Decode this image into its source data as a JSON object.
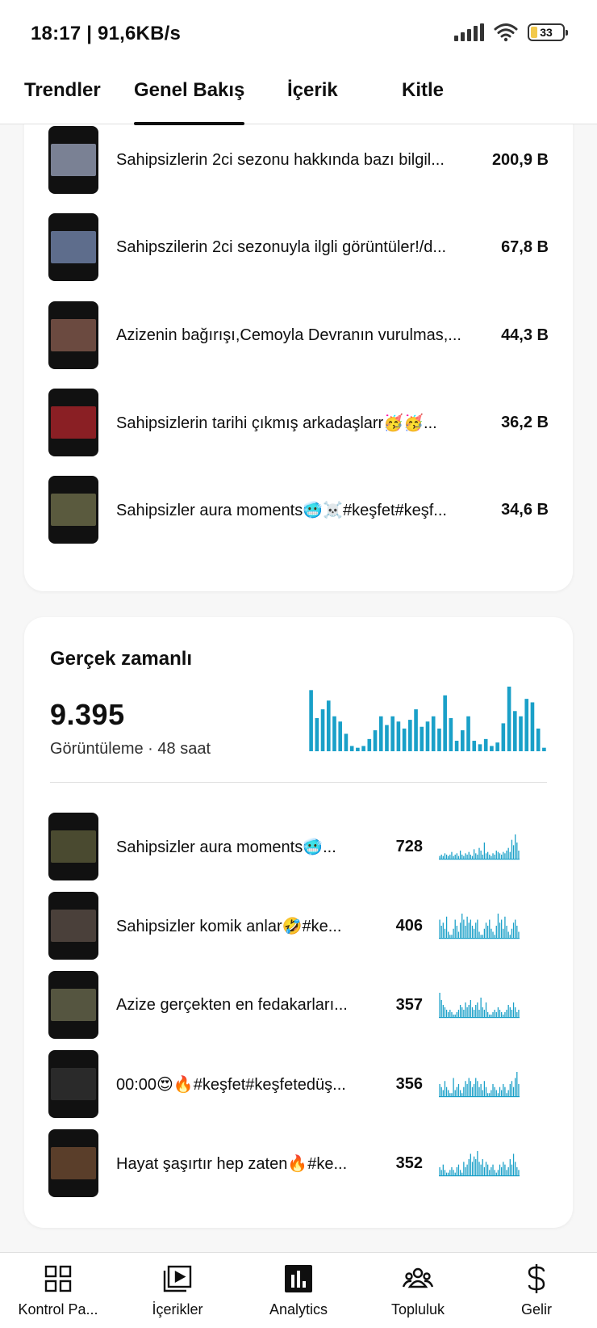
{
  "status_bar": {
    "time": "18:17 | 91,6KB/s",
    "battery": "33"
  },
  "tabs": [
    {
      "label": "Trendler"
    },
    {
      "label": "Genel Bakış",
      "active": true
    },
    {
      "label": "İçerik"
    },
    {
      "label": "Kitle"
    }
  ],
  "top_content": [
    {
      "title": "Sahipsizlerin 2ci sezonu hakkında bazı bilgil...",
      "value": "200,9 B",
      "thumb_color": "#7a8194"
    },
    {
      "title": "Sahipszilerin 2ci sezonuyla ilgli görüntüler!/d...",
      "value": "67,8 B",
      "thumb_color": "#5e6d8c"
    },
    {
      "title": "Azizenin bağırışı,Cemoyla Devranın vurulmas,...",
      "value": "44,3 B",
      "thumb_color": "#6b4a40"
    },
    {
      "title": "Sahipsizlerin tarihi çıkmış arkadaşlarr🥳🥳...",
      "value": "36,2 B",
      "thumb_color": "#8a1f24"
    },
    {
      "title": "Sahipsizler aura moments🥶☠️#keşfet#keşf...",
      "value": "34,6 B",
      "thumb_color": "#5a5a3e"
    }
  ],
  "realtime": {
    "title": "Gerçek zamanlı",
    "count": "9.395",
    "subtitle": "Görüntüleme · 48 saat",
    "color": "#1aa0c8",
    "bars": [
      70,
      38,
      48,
      58,
      40,
      34,
      20,
      6,
      4,
      6,
      14,
      24,
      40,
      30,
      40,
      34,
      26,
      36,
      48,
      28,
      34,
      40,
      26,
      64,
      38,
      12,
      24,
      40,
      12,
      8,
      14,
      6,
      10,
      32,
      74,
      46,
      40,
      60,
      56,
      26,
      4
    ]
  },
  "realtime_items": [
    {
      "title": "Sahipsizler aura moments🥶...",
      "value": "728",
      "thumb_color": "#4a4a30",
      "spark": [
        2,
        3,
        2,
        4,
        3,
        2,
        3,
        5,
        2,
        3,
        4,
        2,
        6,
        3,
        2,
        4,
        3,
        5,
        3,
        2,
        7,
        4,
        3,
        8,
        6,
        3,
        12,
        4,
        5,
        3,
        2,
        4,
        3,
        6,
        5,
        4,
        3,
        5,
        4,
        6,
        8,
        5,
        14,
        10,
        18,
        12,
        6
      ]
    },
    {
      "title": "Sahipsizler komik anlar🤣#ke...",
      "value": "406",
      "thumb_color": "#4a403a",
      "spark": [
        6,
        4,
        5,
        3,
        7,
        2,
        1,
        1,
        3,
        6,
        4,
        2,
        5,
        8,
        6,
        4,
        7,
        5,
        6,
        4,
        3,
        5,
        6,
        2,
        1,
        1,
        3,
        5,
        4,
        6,
        3,
        2,
        1,
        4,
        8,
        5,
        6,
        3,
        7,
        4,
        2,
        1,
        3,
        5,
        6,
        4,
        2
      ]
    },
    {
      "title": "Azize gerçekten en fedakarları...",
      "value": "357",
      "thumb_color": "#555540",
      "spark": [
        10,
        7,
        5,
        4,
        3,
        2,
        3,
        2,
        1,
        1,
        2,
        3,
        5,
        4,
        3,
        6,
        4,
        5,
        7,
        4,
        3,
        5,
        6,
        3,
        8,
        4,
        3,
        6,
        2,
        1,
        1,
        2,
        3,
        2,
        4,
        3,
        2,
        1,
        2,
        3,
        5,
        4,
        3,
        6,
        4,
        2,
        3
      ]
    },
    {
      "title": "00:00😍🔥#keşfet#keşfetedüş...",
      "value": "356",
      "thumb_color": "#2a2a2a",
      "spark": [
        4,
        3,
        2,
        5,
        3,
        2,
        1,
        1,
        6,
        2,
        3,
        4,
        2,
        1,
        3,
        5,
        4,
        6,
        5,
        3,
        4,
        6,
        5,
        3,
        4,
        2,
        5,
        3,
        1,
        1,
        2,
        4,
        3,
        2,
        1,
        3,
        2,
        4,
        3,
        1,
        2,
        4,
        5,
        3,
        6,
        8,
        4
      ]
    },
    {
      "title": "Hayat şaşırtır hep zaten🔥#ke...",
      "value": "352",
      "thumb_color": "#5a3e2a",
      "spark": [
        3,
        2,
        4,
        2,
        1,
        1,
        2,
        3,
        2,
        1,
        3,
        4,
        2,
        1,
        5,
        3,
        4,
        6,
        8,
        5,
        7,
        6,
        9,
        5,
        4,
        6,
        3,
        5,
        4,
        2,
        3,
        4,
        2,
        1,
        2,
        4,
        3,
        5,
        4,
        2,
        3,
        6,
        4,
        8,
        5,
        3,
        2
      ]
    }
  ],
  "bottom_nav": [
    {
      "label": "Kontrol Pa...",
      "icon": "dashboard-icon"
    },
    {
      "label": "İçerikler",
      "icon": "content-icon"
    },
    {
      "label": "Analytics",
      "icon": "analytics-icon"
    },
    {
      "label": "Topluluk",
      "icon": "community-icon"
    },
    {
      "label": "Gelir",
      "icon": "dollar-icon"
    }
  ]
}
